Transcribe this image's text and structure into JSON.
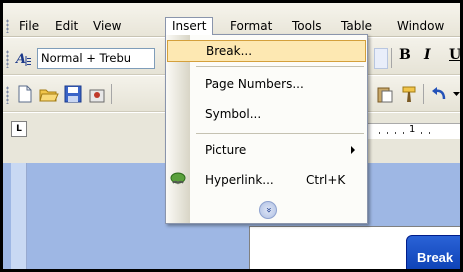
{
  "menubar": {
    "items": [
      {
        "label": "File"
      },
      {
        "label": "Edit"
      },
      {
        "label": "View"
      },
      {
        "label": "Insert"
      },
      {
        "label": "Format"
      },
      {
        "label": "Tools"
      },
      {
        "label": "Table"
      },
      {
        "label": "Window"
      }
    ]
  },
  "formatting_toolbar": {
    "style_value": "Normal + Trebu",
    "bold_label": "B",
    "italic_label": "I",
    "underline_label": "U"
  },
  "insert_menu": {
    "items": [
      {
        "label": "Break...",
        "shortcut": "",
        "highlighted": true
      },
      {
        "label": "Page Numbers...",
        "shortcut": ""
      },
      {
        "label": "Symbol...",
        "shortcut": ""
      },
      {
        "label": "Picture",
        "shortcut": "",
        "has_submenu": true
      },
      {
        "label": "Hyperlink...",
        "shortcut": "Ctrl+K",
        "icon": "hyperlink-icon"
      }
    ],
    "expand_icon": "chevrons-down-icon"
  },
  "ruler": {
    "tab_selector": "L",
    "mark": "1"
  },
  "dialog_title_fragment": "Break",
  "colors": {
    "menu_highlight": "#fde8b2",
    "menu_highlight_border": "#d4a03c",
    "doc_background": "#9eb7e4",
    "dialog_title": "#0b3fb3"
  }
}
